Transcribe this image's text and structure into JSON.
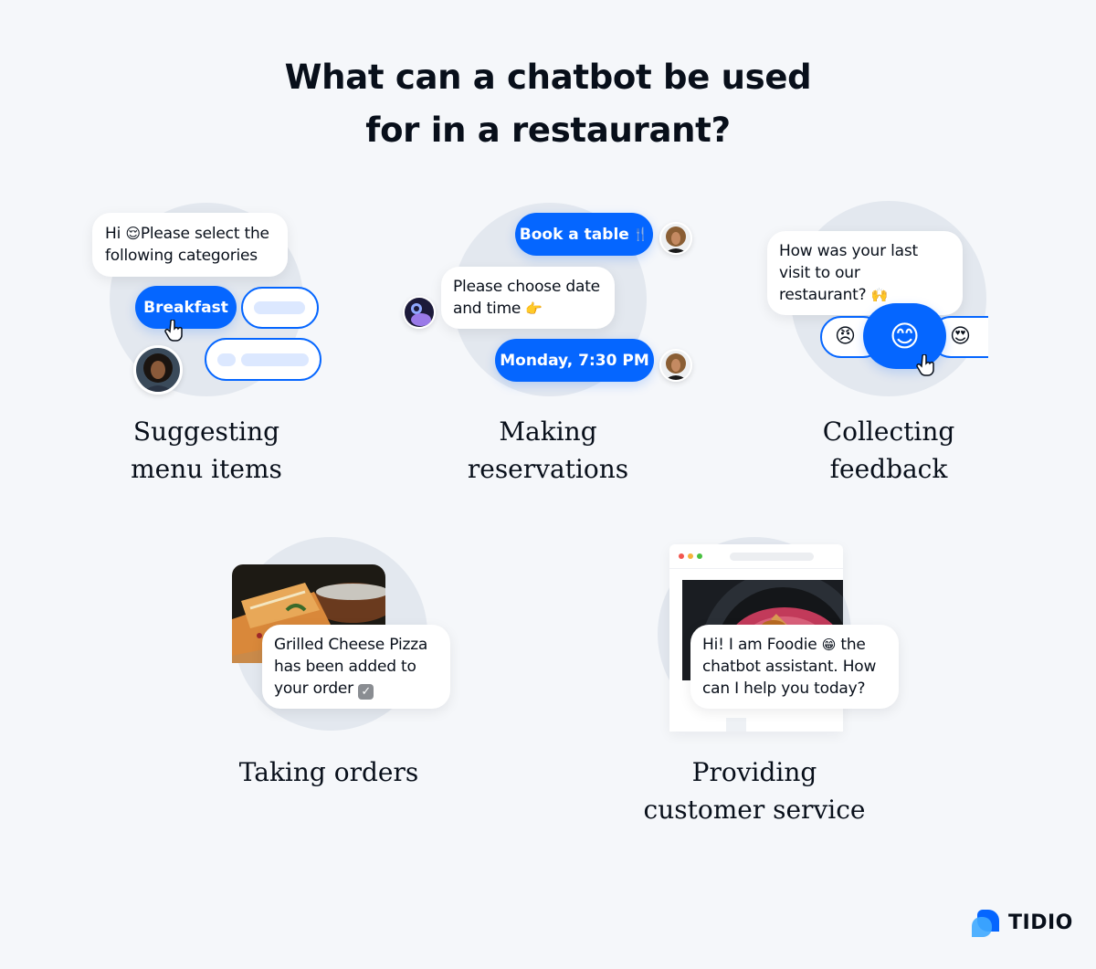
{
  "title": {
    "line1": "What can a chatbot be used",
    "line2": "for in a restaurant?"
  },
  "colors": {
    "accent": "#0566ff",
    "background": "#f5f7fa",
    "circle": "#e3e8ef",
    "text": "#080f1a"
  },
  "panels": [
    {
      "id": "suggesting-menu-items",
      "label_line1": "Suggesting",
      "label_line2": "menu items",
      "bot_message_prefix": "Hi",
      "bot_message_emoji": "😌",
      "bot_message_rest": "Please select the following categories",
      "selected_option": "Breakfast"
    },
    {
      "id": "making-reservations",
      "label_line1": "Making",
      "label_line2": "reservations",
      "user_message_1": "Book a table",
      "user_message_1_emoji": "🍴",
      "bot_message": "Please choose date and time",
      "bot_message_emoji": "👉",
      "user_message_2": "Monday, 7:30 PM"
    },
    {
      "id": "collecting-feedback",
      "label_line1": "Collecting",
      "label_line2": "feedback",
      "bot_message": "How was your last visit to our restaurant?",
      "bot_message_emoji": "🙌",
      "ratings": [
        "😠",
        "😊",
        "😍"
      ],
      "selected_rating": "😊"
    },
    {
      "id": "taking-orders",
      "label_line1": "Taking orders",
      "bot_message": "Grilled Cheese Pizza has been added to your order",
      "bot_message_emoji": "☑️"
    },
    {
      "id": "providing-customer-service",
      "label_line1": "Providing",
      "label_line2": "customer service",
      "bot_message_part1": "Hi! I am Foodie",
      "bot_message_emoji": "😁",
      "bot_message_part2": "the chatbot assistant. How can I help you today?"
    }
  ],
  "brand": {
    "name": "TIDIO"
  }
}
